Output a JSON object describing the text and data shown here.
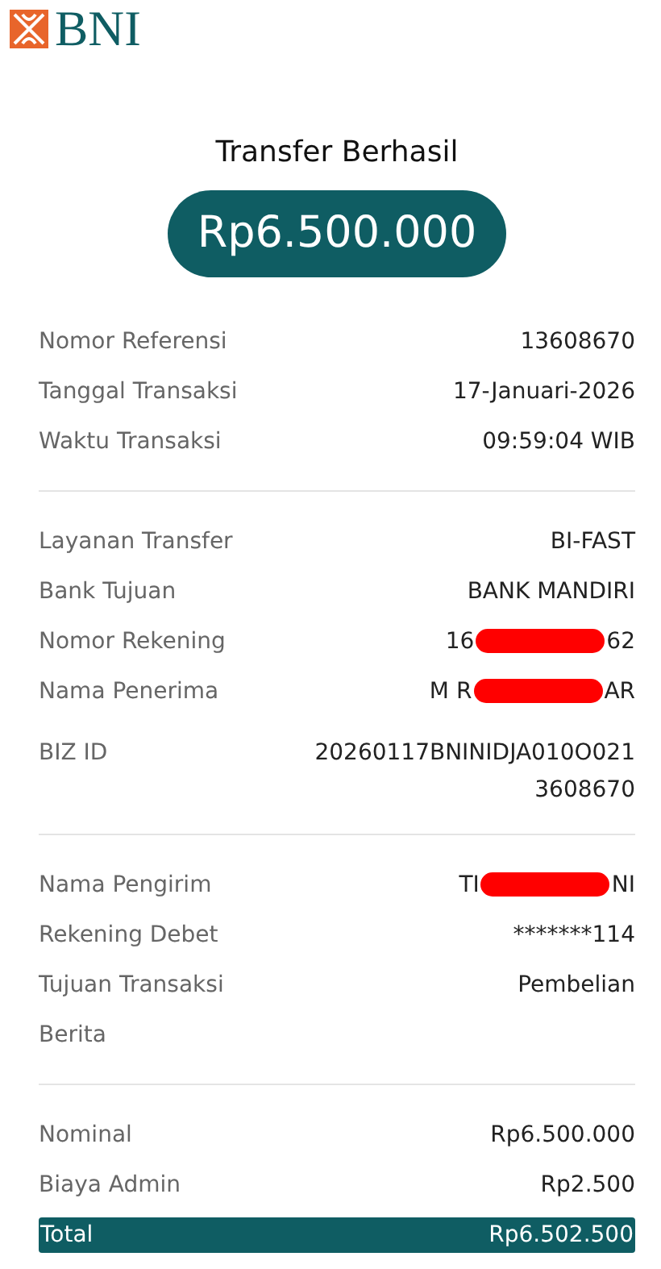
{
  "brand": {
    "name": "BNI"
  },
  "title": "Transfer Berhasil",
  "amount": "Rp6.500.000",
  "sections": [
    {
      "rows": [
        {
          "kind": "plain",
          "label": "Nomor Referensi",
          "value": "13608670"
        },
        {
          "kind": "plain",
          "label": "Tanggal Transaksi",
          "value": "17-Januari-2026"
        },
        {
          "kind": "plain",
          "label": "Waktu Transaksi",
          "value": "09:59:04 WIB"
        }
      ]
    },
    {
      "rows": [
        {
          "kind": "plain",
          "label": "Layanan Transfer",
          "value": "BI-FAST"
        },
        {
          "kind": "plain",
          "label": "Bank Tujuan",
          "value": "BANK MANDIRI"
        },
        {
          "kind": "redacted",
          "label": "Nomor Rekening",
          "value_start": "16",
          "value_end": "62"
        },
        {
          "kind": "redacted",
          "label": "Nama Penerima",
          "value_start": "M R",
          "value_end": "AR"
        },
        {
          "kind": "wrapped",
          "label": "BIZ ID",
          "value": "20260117BNINIDJA010O0213608670"
        }
      ]
    },
    {
      "rows": [
        {
          "kind": "redacted",
          "label": "Nama Pengirim",
          "value_start": "TI",
          "value_end": "NI"
        },
        {
          "kind": "plain",
          "label": "Rekening Debet",
          "value": "*******114"
        },
        {
          "kind": "plain",
          "label": "Tujuan Transaksi",
          "value": "Pembelian"
        },
        {
          "kind": "label_only",
          "label": "Berita"
        }
      ]
    },
    {
      "rows": [
        {
          "kind": "plain",
          "label": "Nominal",
          "value": "Rp6.500.000"
        },
        {
          "kind": "plain",
          "label": "Biaya Admin",
          "value": "Rp2.500"
        },
        {
          "kind": "total",
          "label": "Total",
          "value": "Rp6.502.500"
        }
      ]
    }
  ]
}
